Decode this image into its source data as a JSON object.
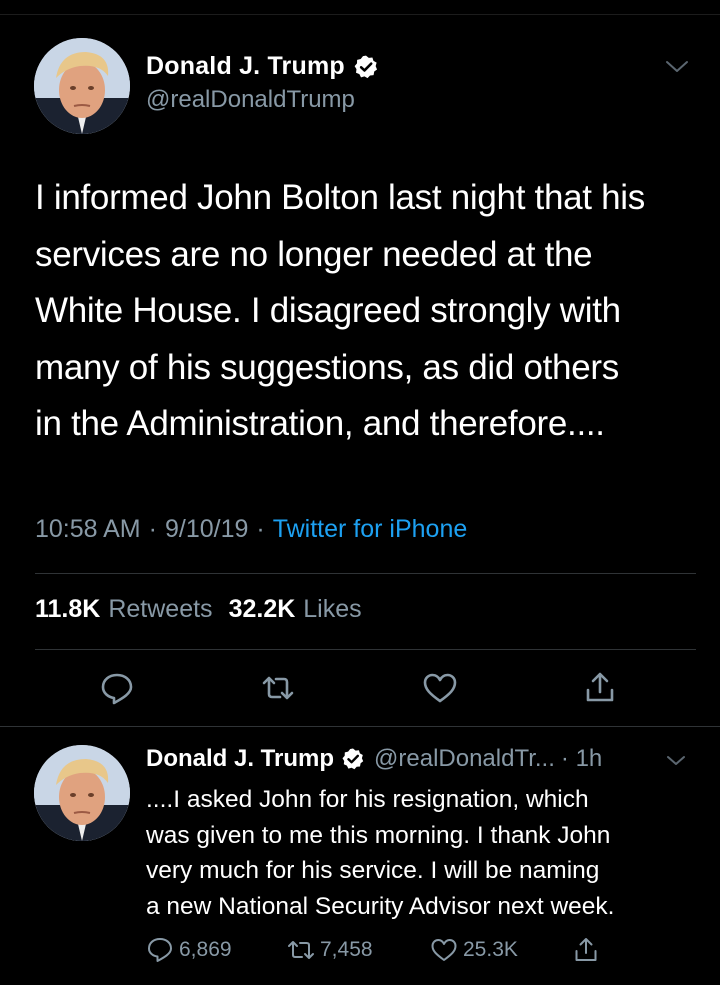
{
  "colors": {
    "background": "#000000",
    "primary_text": "#ffffff",
    "secondary_text": "#8899a6",
    "link_blue": "#1da1f2",
    "divider": "#2f3336"
  },
  "main_tweet": {
    "avatar_icon": "profile-photo",
    "author_name": "Donald J. Trump",
    "verified_icon": "verified-badge-icon",
    "handle": "@realDonaldTrump",
    "menu_icon": "chevron-down-icon",
    "text": "I informed John Bolton last night that his\nservices are no longer needed at the\nWhite House. I disagreed strongly with\nmany of his suggestions, as did others\nin the Administration, and therefore....",
    "time": "10:58 AM",
    "date": "9/10/19",
    "separator": "·",
    "source": "Twitter for iPhone",
    "retweets_count": "11.8K",
    "retweets_label": "Retweets",
    "likes_count": "32.2K",
    "likes_label": "Likes",
    "actions": [
      "reply-icon",
      "retweet-icon",
      "like-icon",
      "share-icon"
    ]
  },
  "reply_tweet": {
    "author_name": "Donald J. Trump",
    "handle": "@realDonaldTr...",
    "time": "· 1h",
    "text": "....I asked John for his resignation, which\nwas given to me this morning. I thank John\nvery much for his service. I will be naming\na new National Security Advisor next week.",
    "replies": "6,869",
    "retweets": "7,458",
    "likes": "25.3K"
  }
}
